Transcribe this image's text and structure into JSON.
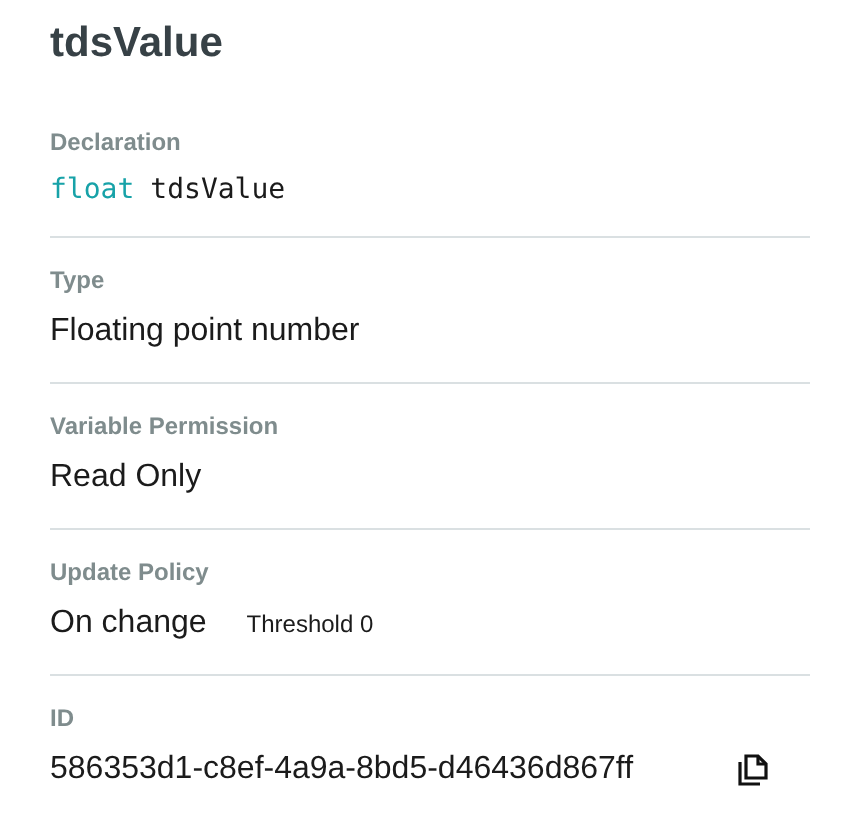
{
  "title": "tdsValue",
  "sections": [
    {
      "kind": "code",
      "label": "Declaration",
      "keyword": "float",
      "value": "tdsValue"
    },
    {
      "kind": "text",
      "label": "Type",
      "value": "Floating point number"
    },
    {
      "kind": "text",
      "label": "Variable Permission",
      "value": "Read Only"
    },
    {
      "kind": "note",
      "label": "Update Policy",
      "value": "On change",
      "note": "Threshold 0"
    },
    {
      "kind": "copy",
      "label": "ID",
      "value": "586353d1-c8ef-4a9a-8bd5-d46436d867ff"
    }
  ]
}
